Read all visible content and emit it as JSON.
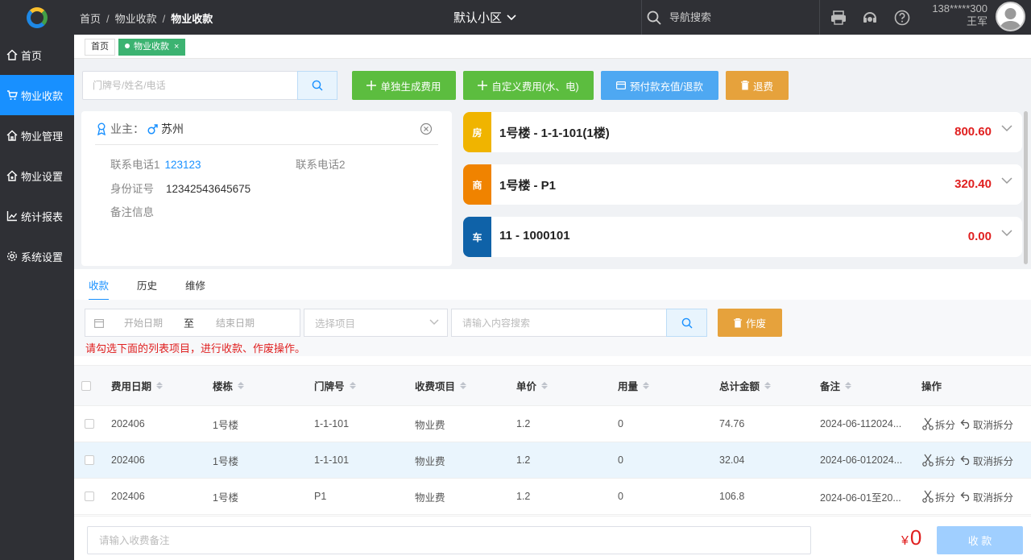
{
  "breadcrumb": [
    "首页",
    "物业收款",
    "物业收款"
  ],
  "community": "默认小区",
  "top_search": {
    "placeholder": "导航搜索"
  },
  "user": {
    "phone": "138*****300",
    "name": "王军"
  },
  "sidebar": {
    "items": [
      {
        "label": "首页",
        "icon": "home-icon"
      },
      {
        "label": "物业收款",
        "icon": "cart-icon",
        "active": true
      },
      {
        "label": "物业管理",
        "icon": "building-icon"
      },
      {
        "label": "物业设置",
        "icon": "gear-icon"
      },
      {
        "label": "统计报表",
        "icon": "chart-icon"
      },
      {
        "label": "系统设置",
        "icon": "settings-icon"
      }
    ]
  },
  "tabs": {
    "home": "首页",
    "active": "物业收款"
  },
  "actions": {
    "search_placeholder": "门牌号/姓名/电话",
    "generate_fee": "单独生成费用",
    "custom_fee": "自定义费用(水、电)",
    "prepay": "预付款充值/退款",
    "refund": "退费"
  },
  "owner": {
    "label": "业主：",
    "name": "苏州",
    "phone1_label": "联系电话1",
    "phone1": "123123",
    "phone2_label": "联系电话2",
    "phone2": "",
    "id_label": "身份证号",
    "id": "12342543645675",
    "note_label": "备注信息",
    "note": ""
  },
  "properties": [
    {
      "tag": "房",
      "title": "1号楼 - 1-1-101(1楼)",
      "amount": "800.60",
      "color": "#f0b400"
    },
    {
      "tag": "商",
      "title": "1号楼 - P1",
      "amount": "320.40",
      "color": "#f08300"
    },
    {
      "tag": "车",
      "title": "11 - 1000101",
      "amount": "0.00",
      "color": "#0f62a8"
    }
  ],
  "subtabs": [
    "收款",
    "历史",
    "维修"
  ],
  "filters": {
    "start_date": "开始日期",
    "to": "至",
    "end_date": "结束日期",
    "select_item": "选择项目",
    "content_search": "请输入内容搜索",
    "void": "作废"
  },
  "hint": "请勾选下面的列表项目，进行收款、作废操作。",
  "table": {
    "headers": [
      "费用日期",
      "楼栋",
      "门牌号",
      "收费项目",
      "单价",
      "用量",
      "总计金额",
      "备注",
      "操作"
    ],
    "rows": [
      {
        "date": "202406",
        "building": "1号楼",
        "unit": "1-1-101",
        "item": "物业费",
        "price": "1.2",
        "usage": "0",
        "total": "74.76",
        "note": "2024-06-112024..."
      },
      {
        "date": "202406",
        "building": "1号楼",
        "unit": "1-1-101",
        "item": "物业费",
        "price": "1.2",
        "usage": "0",
        "total": "32.04",
        "note": "2024-06-012024..."
      },
      {
        "date": "202406",
        "building": "1号楼",
        "unit": "P1",
        "item": "物业费",
        "price": "1.2",
        "usage": "0",
        "total": "106.8",
        "note": "2024-06-01至20..."
      }
    ],
    "split_label": "拆分",
    "cancel_split_label": "取消拆分"
  },
  "bottom": {
    "remark_placeholder": "请输入收费备注",
    "currency": "¥",
    "total": "0",
    "collect": "收 款"
  }
}
